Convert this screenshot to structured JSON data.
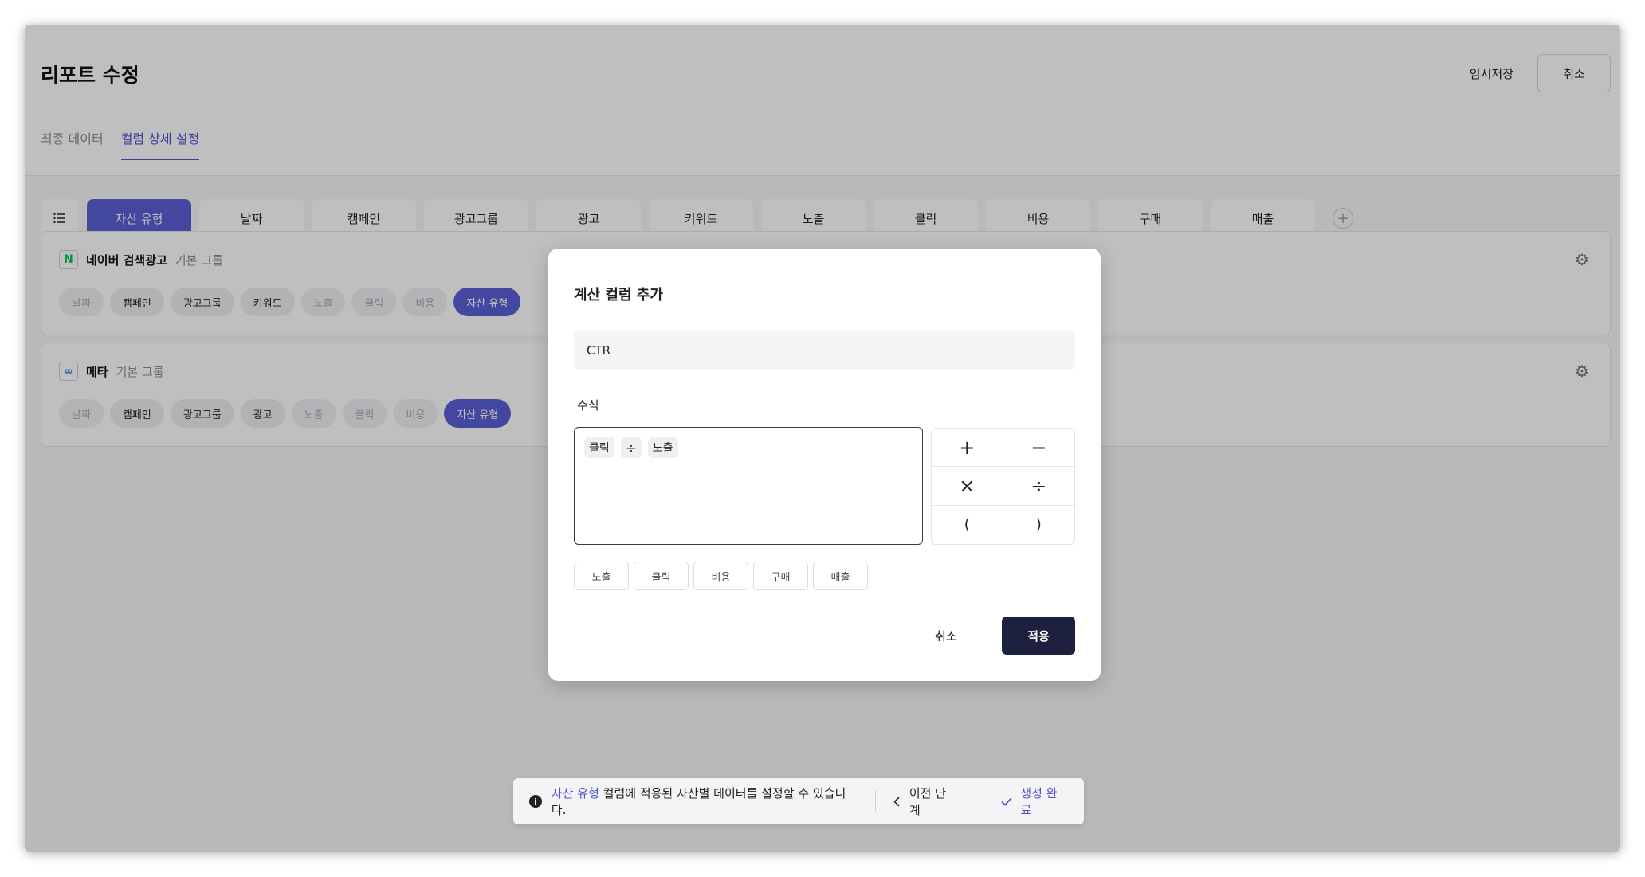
{
  "page": {
    "title": "리포트 수정",
    "temp_save": "임시저장",
    "cancel": "취소"
  },
  "tabs": [
    {
      "label": "최종 데이터",
      "active": false
    },
    {
      "label": "컬럼 상세 설정",
      "active": true
    }
  ],
  "columns": [
    {
      "label": "자산 유형",
      "active": true
    },
    {
      "label": "날짜"
    },
    {
      "label": "캠페인"
    },
    {
      "label": "광고그룹"
    },
    {
      "label": "광고"
    },
    {
      "label": "키워드"
    },
    {
      "label": "노출"
    },
    {
      "label": "클릭"
    },
    {
      "label": "비용"
    },
    {
      "label": "구매"
    },
    {
      "label": "매출"
    }
  ],
  "groups": [
    {
      "logo": "N",
      "name": "네이버 검색광고",
      "sub": "기본 그룹",
      "chips": [
        {
          "label": "날짜",
          "state": "muted"
        },
        {
          "label": "캠페인",
          "state": "normal"
        },
        {
          "label": "광고그룹",
          "state": "normal"
        },
        {
          "label": "키워드",
          "state": "normal"
        },
        {
          "label": "노출",
          "state": "muted"
        },
        {
          "label": "클릭",
          "state": "muted"
        },
        {
          "label": "비용",
          "state": "muted"
        },
        {
          "label": "자산 유형",
          "state": "active"
        }
      ]
    },
    {
      "logo": "∞",
      "name": "메타",
      "sub": "기본 그룹",
      "chips": [
        {
          "label": "날짜",
          "state": "muted"
        },
        {
          "label": "캠페인",
          "state": "normal"
        },
        {
          "label": "광고그룹",
          "state": "normal"
        },
        {
          "label": "광고",
          "state": "normal"
        },
        {
          "label": "노출",
          "state": "muted"
        },
        {
          "label": "클릭",
          "state": "muted"
        },
        {
          "label": "비용",
          "state": "muted"
        },
        {
          "label": "자산 유형",
          "state": "active"
        }
      ]
    }
  ],
  "modal": {
    "title": "계산 컬럼 추가",
    "name_value": "CTR",
    "formula_label": "수식",
    "formula_tokens": [
      "클릭",
      "÷",
      "노출"
    ],
    "operators": [
      "+",
      "−",
      "×",
      "÷",
      "(",
      ")"
    ],
    "metrics": [
      "노출",
      "클릭",
      "비용",
      "구매",
      "매출"
    ],
    "cancel": "취소",
    "apply": "적용"
  },
  "bottom_bar": {
    "accent": "자산 유형",
    "text": " 컬럼에 적용된 자산별 데이터를 설정할 수 있습니다.",
    "prev": "이전 단계",
    "done": "생성 완료"
  },
  "colors": {
    "accent": "#5b5fd6",
    "dark_button": "#1e2040"
  }
}
